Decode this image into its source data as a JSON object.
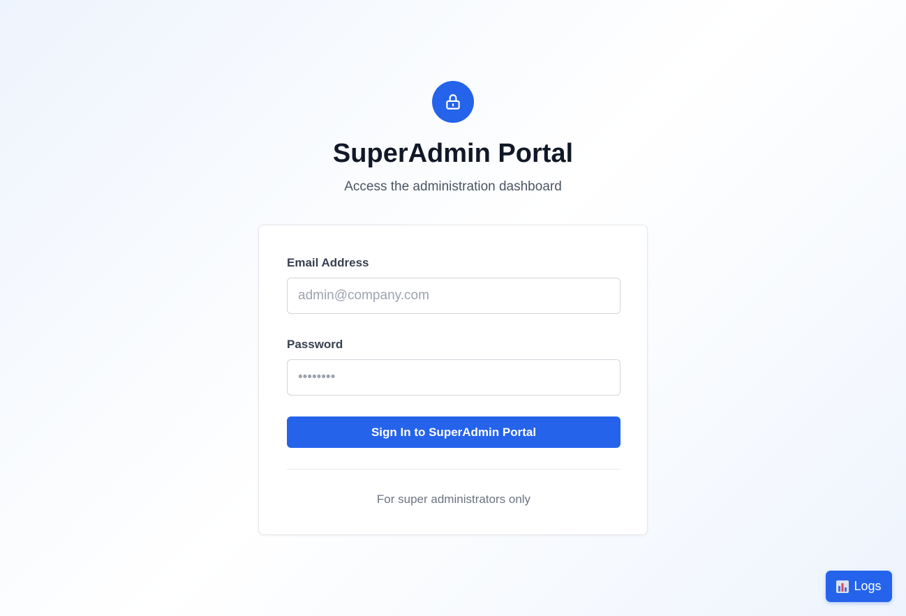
{
  "header": {
    "title": "SuperAdmin Portal",
    "subtitle": "Access the administration dashboard",
    "icon": "lock-icon"
  },
  "form": {
    "email": {
      "label": "Email Address",
      "placeholder": "admin@company.com",
      "value": ""
    },
    "password": {
      "label": "Password",
      "placeholder": "••••••••",
      "value": ""
    },
    "submit_label": "Sign In to SuperAdmin Portal",
    "footer_note": "For super administrators only"
  },
  "logs_button": {
    "label": "Logs",
    "icon": "bar-chart-icon"
  },
  "colors": {
    "accent": "#2563eb",
    "title": "#111827",
    "muted": "#6b7280",
    "border": "#d1d5db"
  }
}
